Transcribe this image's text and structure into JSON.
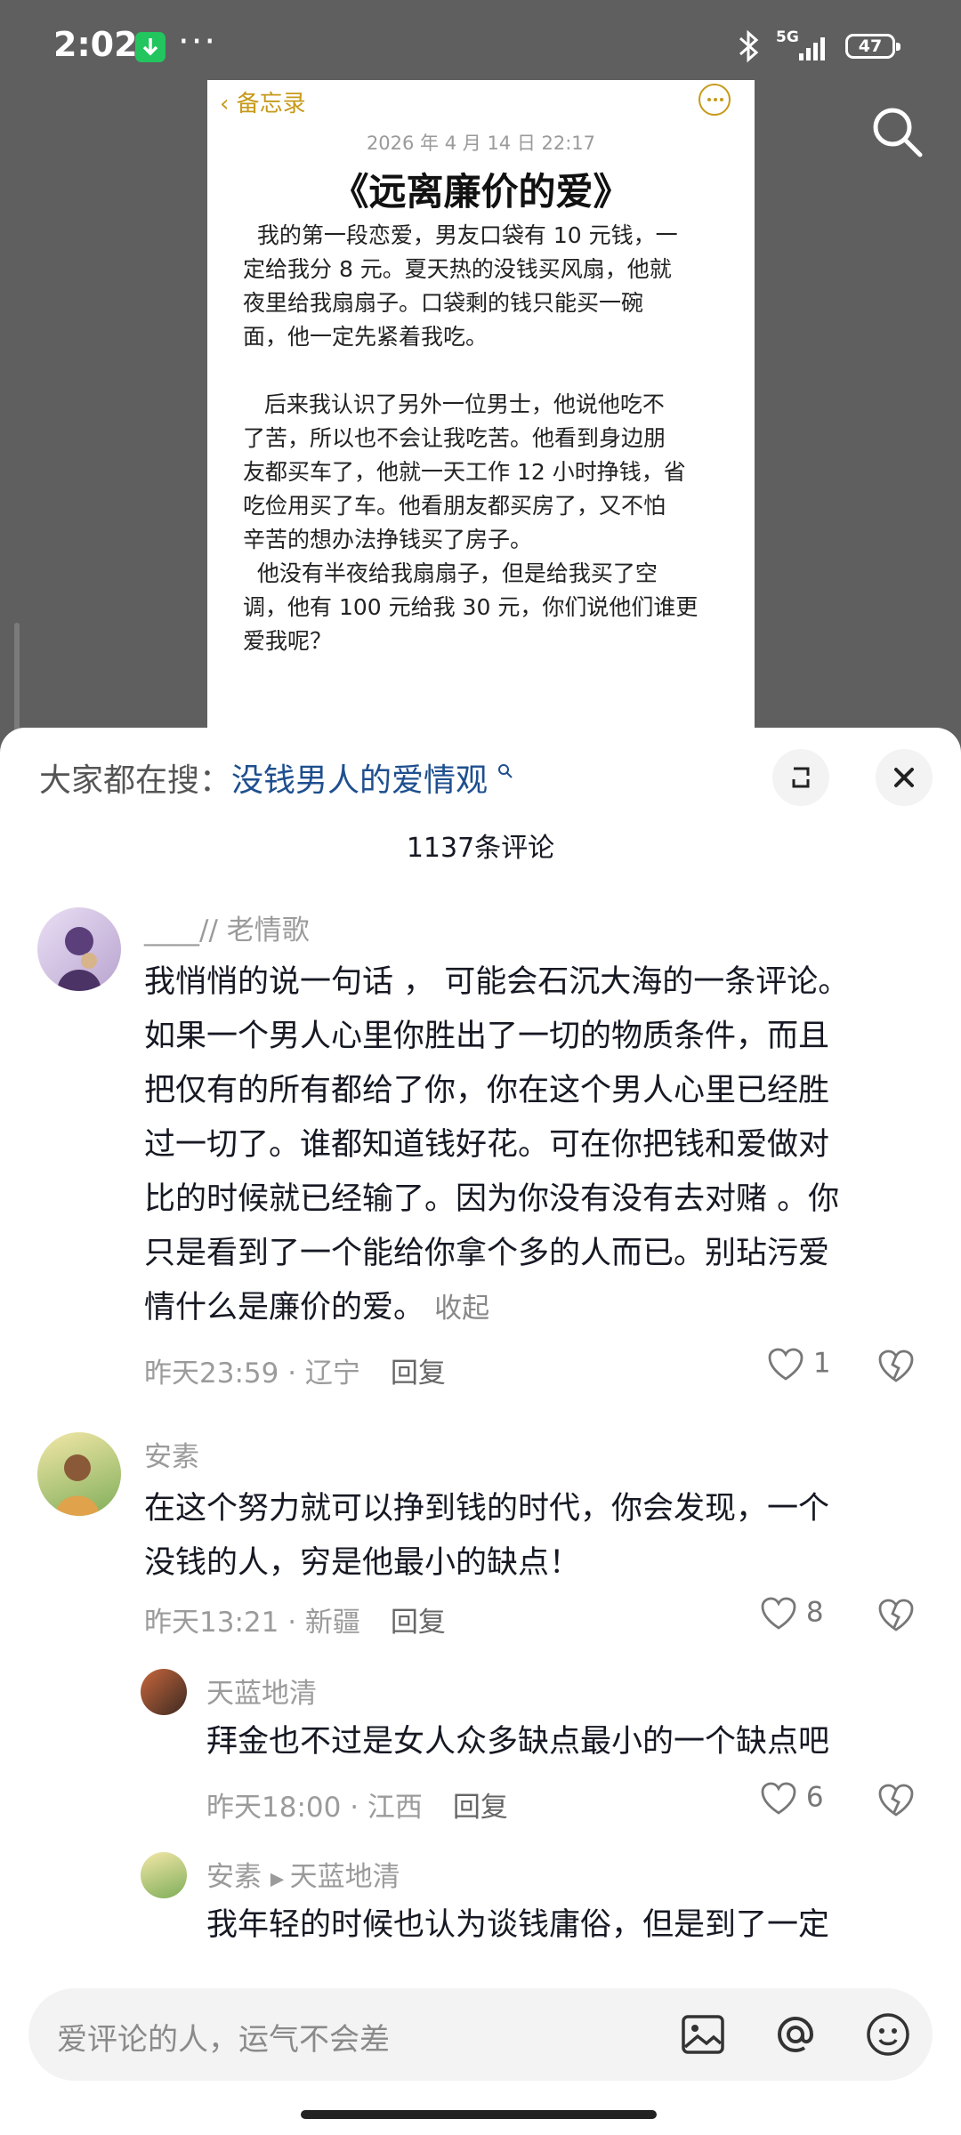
{
  "status_bar": {
    "time": "2:02",
    "network": "5G",
    "battery": "47"
  },
  "memo": {
    "back_label": "备忘录",
    "date": "2026 年 4 月 14 日 22:17",
    "title": "《远离廉价的爱》",
    "p1": [
      "  我的第一段恋爱，男友口袋有 10 元钱，一",
      "定给我分 8 元。夏天热的没钱买风扇，他就",
      "夜里给我扇扇子。口袋剩的钱只能买一碗",
      "面，他一定先紧着我吃。"
    ],
    "p2": [
      "   后来我认识了另外一位男士，他说他吃不",
      "了苦，所以也不会让我吃苦。他看到身边朋",
      "友都买车了，他就一天工作 12 小时挣钱，省",
      "吃俭用买了车。他看朋友都买房了，又不怕",
      "辛苦的想办法挣钱买了房子。",
      "  他没有半夜给我扇扇子，但是给我买了空",
      "调，他有 100 元给我 30 元，你们说他们谁更",
      "爱我呢？"
    ]
  },
  "sheet": {
    "hot_label": "大家都在搜：",
    "hot_query": "没钱男人的爱情观",
    "comment_count": "1137条评论"
  },
  "comments": [
    {
      "author": "____//  老情歌",
      "lines": [
        "我悄悄的说一句话 ， 可能会石沉大海的一条评论。",
        "如果一个男人心里你胜出了一切的物质条件，而且",
        "把仅有的所有都给了你，你在这个男人心里已经胜",
        "过一切了。谁都知道钱好花。可在你把钱和爱做对",
        "比的时候就已经输了。因为你没有没有去对赌 。你",
        "只是看到了一个能给你拿个多的人而已。别玷污爱",
        "情什么是廉价的爱。"
      ],
      "collapse": "收起",
      "time_location": "昨天23:59 · 辽宁",
      "reply": "回复",
      "likes": "1"
    },
    {
      "author": "安素",
      "lines": [
        "在这个努力就可以挣到钱的时代，你会发现，一个",
        "没钱的人，穷是他最小的缺点！"
      ],
      "time_location": "昨天13:21 · 新疆",
      "reply": "回复",
      "likes": "8"
    }
  ],
  "replies": [
    {
      "author": "天蓝地清",
      "text": "拜金也不过是女人众多缺点最小的一个缺点吧",
      "time_location": "昨天18:00 · 江西",
      "reply": "回复",
      "likes": "6"
    },
    {
      "author": "安素",
      "reply_to": "天蓝地清",
      "text": "我年轻的时候也认为谈钱庸俗，但是到了一定"
    }
  ],
  "input": {
    "placeholder": "爱评论的人，运气不会差"
  }
}
